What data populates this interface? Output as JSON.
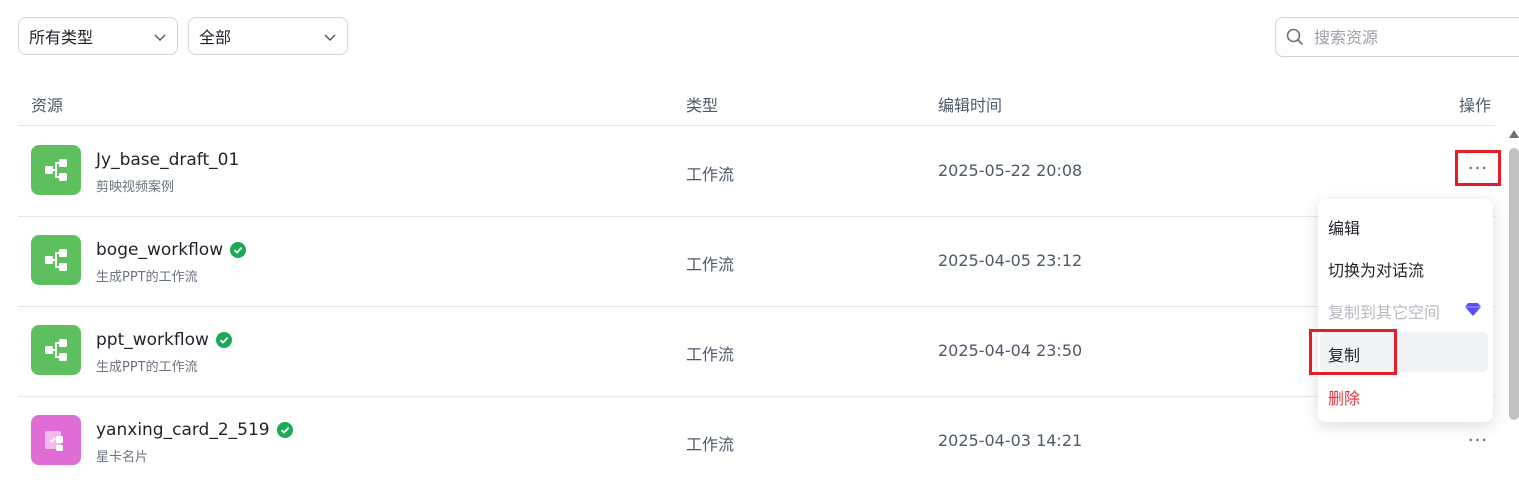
{
  "filters": {
    "type_select": "所有类型",
    "scope_select": "全部"
  },
  "search": {
    "placeholder": "搜索资源"
  },
  "table": {
    "headers": {
      "resource": "资源",
      "type": "类型",
      "edited": "编辑时间",
      "actions": "操作"
    },
    "rows": [
      {
        "name": "Jy_base_draft_01",
        "desc": "剪映视频案例",
        "type": "工作流",
        "time": "2025-05-22 20:08",
        "published": false,
        "icon_color": "#5dbf5e",
        "icon": "workflow-icon"
      },
      {
        "name": "boge_workflow",
        "desc": "生成PPT的工作流",
        "type": "工作流",
        "time": "2025-04-05 23:12",
        "published": true,
        "icon_color": "#5dbf5e",
        "icon": "workflow-icon"
      },
      {
        "name": "ppt_workflow",
        "desc": "生成PPT的工作流",
        "type": "工作流",
        "time": "2025-04-04 23:50",
        "published": true,
        "icon_color": "#5dbf5e",
        "icon": "workflow-icon"
      },
      {
        "name": "yanxing_card_2_519",
        "desc": "星卡名片",
        "type": "工作流",
        "time": "2025-04-03 14:21",
        "published": true,
        "icon_color": "#e06cd6",
        "icon": "card-workflow-icon"
      }
    ]
  },
  "more_button": "···",
  "menu": {
    "items": [
      {
        "label": "编辑",
        "state": "normal"
      },
      {
        "label": "切换为对话流",
        "state": "normal"
      },
      {
        "label": "复制到其它空间",
        "state": "disabled",
        "icon": "diamond-icon"
      },
      {
        "label": "复制",
        "state": "highlighted"
      },
      {
        "label": "删除",
        "state": "danger"
      }
    ]
  },
  "colors": {
    "highlight": "#e41e26",
    "published_badge": "#1aaa55",
    "danger": "#e5343a",
    "premium": "#5b4dff"
  }
}
